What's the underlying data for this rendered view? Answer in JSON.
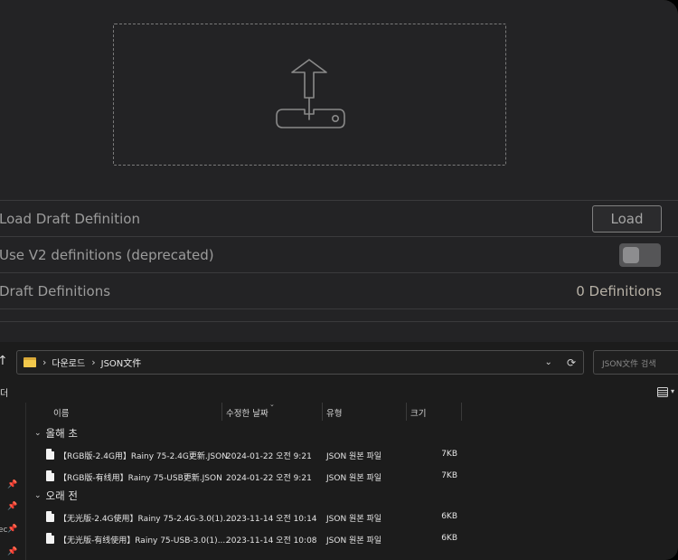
{
  "panel": {
    "rows": [
      {
        "label": "Load Draft Definition",
        "button": "Load"
      },
      {
        "label": "Use V2 definitions (deprecated)",
        "toggle_on": false
      },
      {
        "label": "Draft Definitions",
        "value": "0 Definitions"
      }
    ]
  },
  "explorer": {
    "breadcrumb": [
      "다운로드",
      "JSON文件"
    ],
    "search_placeholder": "JSON文件 검색",
    "toolbar_fragment": "더",
    "sidebar_fragment": "ec",
    "columns": [
      "이름",
      "수정한 날짜",
      "유형",
      "크기"
    ],
    "groups": [
      {
        "title": "올해 초",
        "files": [
          {
            "name": "【RGB版-2.4G用】Rainy 75-2.4G更新.JSON",
            "date": "2024-01-22 오전 9:21",
            "type": "JSON 원본 파일",
            "size": "7KB"
          },
          {
            "name": "【RGB版-有线用】Rainy 75-USB更新.JSON",
            "date": "2024-01-22 오전 9:21",
            "type": "JSON 원본 파일",
            "size": "7KB"
          }
        ]
      },
      {
        "title": "오래 전",
        "files": [
          {
            "name": "【无光版-2.4G使用】Rainy 75-2.4G-3.0(1)....",
            "date": "2023-11-14 오전 10:14",
            "type": "JSON 원본 파일",
            "size": "6KB"
          },
          {
            "name": "【无光版-有线使用】Rainy 75-USB-3.0(1)....",
            "date": "2023-11-14 오전 10:08",
            "type": "JSON 원본 파일",
            "size": "6KB"
          }
        ]
      }
    ]
  }
}
